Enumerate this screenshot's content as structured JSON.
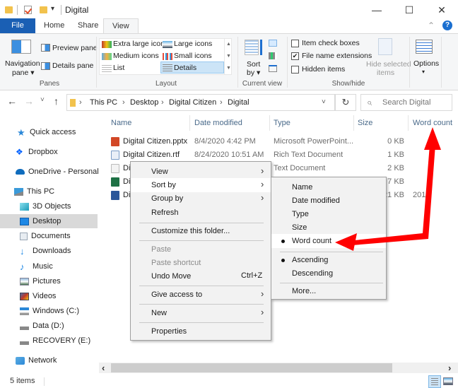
{
  "window": {
    "title": "Digital",
    "controls": {
      "minimize": "—",
      "maximize": "☐",
      "close": "✕"
    },
    "qat_dropdown": "▾"
  },
  "tabs": [
    {
      "label": "File",
      "active": false
    },
    {
      "label": "Home",
      "active": false
    },
    {
      "label": "Share",
      "active": false
    },
    {
      "label": "View",
      "active": true
    }
  ],
  "ribbon": {
    "collapse_icon": "⌃",
    "help_icon": "?",
    "panes": {
      "label": "Panes",
      "navigation_pane": "Navigation",
      "navigation_pane_2": "pane ▾",
      "preview_pane": "Preview pane",
      "details_pane": "Details pane"
    },
    "layout": {
      "label": "Layout",
      "items": [
        "Extra large icons",
        "Large icons",
        "Medium icons",
        "Small icons",
        "List",
        "Details"
      ],
      "selected": "Details"
    },
    "current_view": {
      "label": "Current view",
      "sort_by": "Sort",
      "sort_by_2": "by ▾"
    },
    "show_hide": {
      "label": "Show/hide",
      "item_check_boxes": {
        "label": "Item check boxes",
        "checked": false
      },
      "file_name_extensions": {
        "label": "File name extensions",
        "checked": true
      },
      "hidden_items": {
        "label": "Hidden items",
        "checked": false
      },
      "hide_selected": "Hide selected",
      "hide_selected_2": "items"
    },
    "options": {
      "label": "Options",
      "arrow": "▾"
    }
  },
  "address": {
    "back": "←",
    "forward": "→",
    "recent": "˅",
    "up": "↑",
    "breadcrumb": [
      "This PC",
      "Desktop",
      "Digital Citizen",
      "Digital"
    ],
    "separator": "›",
    "dropdown": "˅",
    "refresh": "↻",
    "search_placeholder": "Search Digital",
    "search_icon": "⌕"
  },
  "sidebar": {
    "items": [
      {
        "label": "Quick access",
        "icon": "star-icon",
        "color": "#2b88d8"
      },
      {
        "label": "Dropbox",
        "icon": "dropbox-icon",
        "color": "#0061fe"
      },
      {
        "label": "OneDrive - Personal",
        "icon": "cloud-icon",
        "color": "#0f6cbd"
      },
      {
        "label": "This PC",
        "icon": "computer-icon",
        "color": "#3a9ad9"
      },
      {
        "label": "3D Objects",
        "icon": "cube-icon",
        "color": "#4fc3d8"
      },
      {
        "label": "Desktop",
        "icon": "desktop-icon",
        "color": "#1e88e5",
        "selected": true
      },
      {
        "label": "Documents",
        "icon": "documents-icon",
        "color": "#9aa7b5"
      },
      {
        "label": "Downloads",
        "icon": "download-icon",
        "color": "#1e88e5"
      },
      {
        "label": "Music",
        "icon": "music-icon",
        "color": "#1e88e5"
      },
      {
        "label": "Pictures",
        "icon": "pictures-icon",
        "color": "#5b8fb9"
      },
      {
        "label": "Videos",
        "icon": "videos-icon",
        "color": "#4a6da7"
      },
      {
        "label": "Windows (C:)",
        "icon": "drive-c-icon",
        "color": "#777"
      },
      {
        "label": "Data (D:)",
        "icon": "drive-icon",
        "color": "#777"
      },
      {
        "label": "RECOVERY (E:)",
        "icon": "drive-icon",
        "color": "#777"
      },
      {
        "label": "Network",
        "icon": "network-icon",
        "color": "#2b88d8"
      }
    ]
  },
  "columns": [
    "Name",
    "Date modified",
    "Type",
    "Size",
    "Word count"
  ],
  "files": [
    {
      "name": "Digital Citizen.pptx",
      "date": "8/4/2020 4:42 PM",
      "type": "Microsoft PowerPoint...",
      "size": "0 KB",
      "words": "",
      "icon": "powerpoint-icon",
      "color": "#d24726"
    },
    {
      "name": "Digital Citizen.rtf",
      "date": "8/24/2020 10:51 AM",
      "type": "Rich Text Document",
      "size": "1 KB",
      "words": "",
      "icon": "rtf-icon",
      "color": "#7a9cc6"
    },
    {
      "name": "Di",
      "date": "",
      "type": "Text Document",
      "size": "2 KB",
      "words": "",
      "icon": "text-file-icon",
      "color": "#cfcfcf"
    },
    {
      "name": "Di",
      "date": "",
      "type": "",
      "size": "7 KB",
      "words": "",
      "icon": "excel-icon",
      "color": "#1e7145"
    },
    {
      "name": "Di",
      "date": "",
      "type": "",
      "size": "21 KB",
      "words": "201",
      "icon": "word-icon",
      "color": "#2b579a"
    }
  ],
  "context_menu": {
    "items": [
      {
        "label": "View",
        "submenu": true
      },
      {
        "label": "Sort by",
        "submenu": true,
        "highlighted": true
      },
      {
        "label": "Group by",
        "submenu": true
      },
      {
        "label": "Refresh"
      },
      {
        "label": "Customize this folder..."
      },
      {
        "label": "Paste",
        "disabled": true
      },
      {
        "label": "Paste shortcut",
        "disabled": true
      },
      {
        "label": "Undo Move",
        "shortcut": "Ctrl+Z"
      },
      {
        "label": "Give access to",
        "submenu": true
      },
      {
        "label": "New",
        "submenu": true
      },
      {
        "label": "Properties"
      }
    ],
    "arrow": "›"
  },
  "sort_submenu": {
    "items": [
      {
        "label": "Name"
      },
      {
        "label": "Date modified"
      },
      {
        "label": "Type"
      },
      {
        "label": "Size"
      },
      {
        "label": "Word count",
        "checked": true,
        "highlighted": true
      },
      {
        "label": "Ascending",
        "checked": true
      },
      {
        "label": "Descending"
      },
      {
        "label": "More..."
      }
    ]
  },
  "annotations": {
    "arrow_color": "#ff0000"
  },
  "status": {
    "items_count": "5 items"
  },
  "scrollbar": {
    "left": "‹",
    "right": "›"
  }
}
